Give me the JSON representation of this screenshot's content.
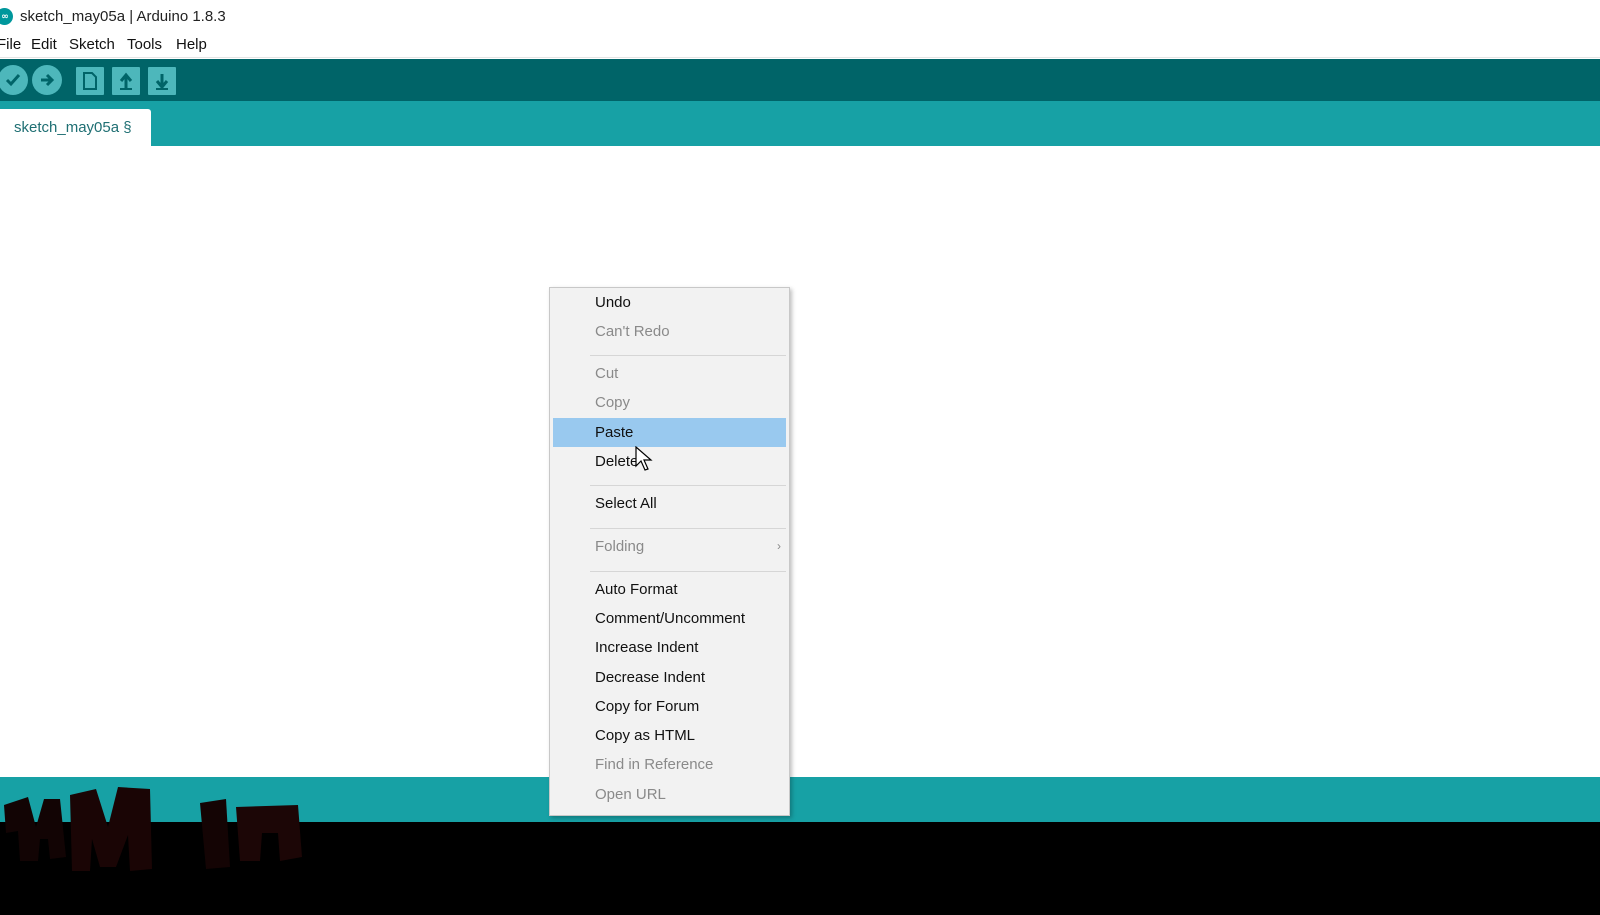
{
  "window": {
    "title": "sketch_may05a | Arduino 1.8.3",
    "app_icon_glyph": "∞"
  },
  "menubar": {
    "items": [
      "File",
      "Edit",
      "Sketch",
      "Tools",
      "Help"
    ]
  },
  "toolbar": {
    "buttons": [
      {
        "name": "verify",
        "icon": "check-icon"
      },
      {
        "name": "upload",
        "icon": "arrow-right-icon"
      },
      {
        "name": "new",
        "icon": "new-file-icon"
      },
      {
        "name": "open",
        "icon": "arrow-up-icon"
      },
      {
        "name": "save",
        "icon": "arrow-down-icon"
      }
    ]
  },
  "tabs": [
    {
      "label": "sketch_may05a §"
    }
  ],
  "context_menu": {
    "items": [
      {
        "label": "Undo",
        "enabled": true
      },
      {
        "label": "Can't Redo",
        "enabled": false
      },
      {
        "label": "Cut",
        "enabled": false
      },
      {
        "label": "Copy",
        "enabled": false
      },
      {
        "label": "Paste",
        "enabled": true,
        "highlighted": true
      },
      {
        "label": "Delete",
        "enabled": true
      },
      {
        "label": "Select All",
        "enabled": true
      },
      {
        "label": "Folding",
        "enabled": false,
        "submenu": true
      },
      {
        "label": "Auto Format",
        "enabled": true
      },
      {
        "label": "Comment/Uncomment",
        "enabled": true
      },
      {
        "label": "Increase Indent",
        "enabled": true
      },
      {
        "label": "Decrease Indent",
        "enabled": true
      },
      {
        "label": "Copy for Forum",
        "enabled": true
      },
      {
        "label": "Copy as HTML",
        "enabled": true
      },
      {
        "label": "Find in Reference",
        "enabled": false
      },
      {
        "label": "Open URL",
        "enabled": false
      }
    ]
  },
  "colors": {
    "toolbar": "#006468",
    "tabbar": "#17a1a5",
    "highlight": "#99c9ef",
    "console": "#000000"
  }
}
